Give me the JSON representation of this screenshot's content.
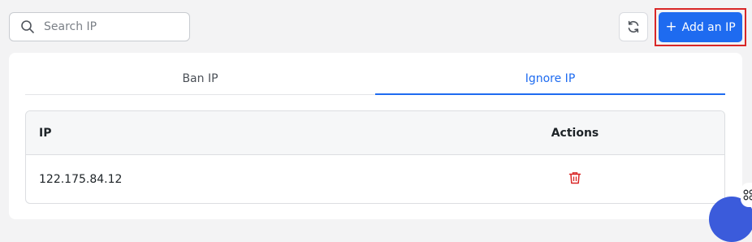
{
  "search": {
    "placeholder": "Search IP",
    "value": ""
  },
  "toolbar": {
    "refresh_icon": "refresh-icon",
    "add_label": "Add an IP",
    "add_icon": "+"
  },
  "tabs": [
    {
      "label": "Ban IP",
      "active": false
    },
    {
      "label": "Ignore IP",
      "active": true
    }
  ],
  "table": {
    "columns": [
      "IP",
      "Actions"
    ],
    "rows": [
      {
        "ip": "122.175.84.12",
        "action_icon": "trash-icon"
      }
    ]
  },
  "colors": {
    "accent": "#1e6bf0",
    "danger": "#d92727",
    "highlight": "#d92727"
  }
}
